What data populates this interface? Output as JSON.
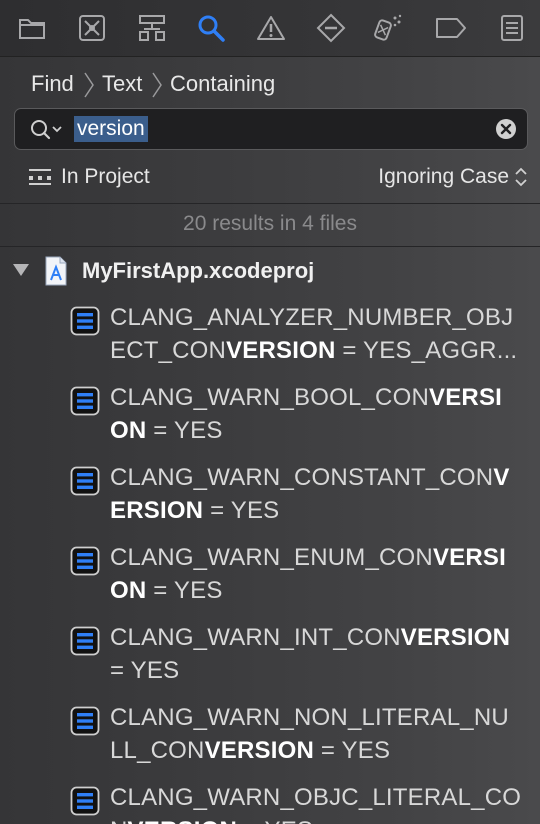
{
  "toolbar": {
    "icons": [
      "folder-icon",
      "source-control-icon",
      "hierarchy-icon",
      "search-icon",
      "warning-icon",
      "breakpoint-icon",
      "debug-icon",
      "tag-icon",
      "report-icon"
    ],
    "active_color": "#2f7ff6"
  },
  "breadcrumb": {
    "items": [
      "Find",
      "Text",
      "Containing"
    ]
  },
  "search": {
    "value": "version"
  },
  "scope": {
    "location": "In Project",
    "case_mode": "Ignoring Case"
  },
  "summary": "20 results in 4 files",
  "file": {
    "name": "MyFirstApp.xcodeproj"
  },
  "results": [
    {
      "line1": [
        "CLANG_ANALYZER_NUMBER_OBJ",
        "",
        ""
      ],
      "line2": [
        "ECT_CON",
        "VERSION",
        " = YES_AGGR..."
      ]
    },
    {
      "line1": [
        "CLANG_WARN_BOOL_CON",
        "VERSI",
        ""
      ],
      "line2": [
        "",
        "ON",
        " = YES"
      ]
    },
    {
      "line1": [
        "CLANG_WARN_CONSTANT_CON",
        "V",
        ""
      ],
      "line2": [
        "",
        "ERSION",
        " = YES"
      ]
    },
    {
      "line1": [
        "CLANG_WARN_ENUM_CON",
        "VERSI",
        ""
      ],
      "line2": [
        "",
        "ON",
        " = YES"
      ]
    },
    {
      "line1": [
        "CLANG_WARN_INT_CON",
        "VERSION",
        ""
      ],
      "line2": [
        "= YES",
        "",
        ""
      ]
    },
    {
      "line1": [
        "CLANG_WARN_NON_LITERAL_NU",
        "",
        ""
      ],
      "line2": [
        "LL_CON",
        "VERSION",
        " = YES"
      ]
    },
    {
      "line1": [
        "CLANG_WARN_OBJC_LITERAL_CO",
        "",
        ""
      ],
      "line2": [
        "N",
        "VERSION",
        " = YES"
      ]
    }
  ]
}
